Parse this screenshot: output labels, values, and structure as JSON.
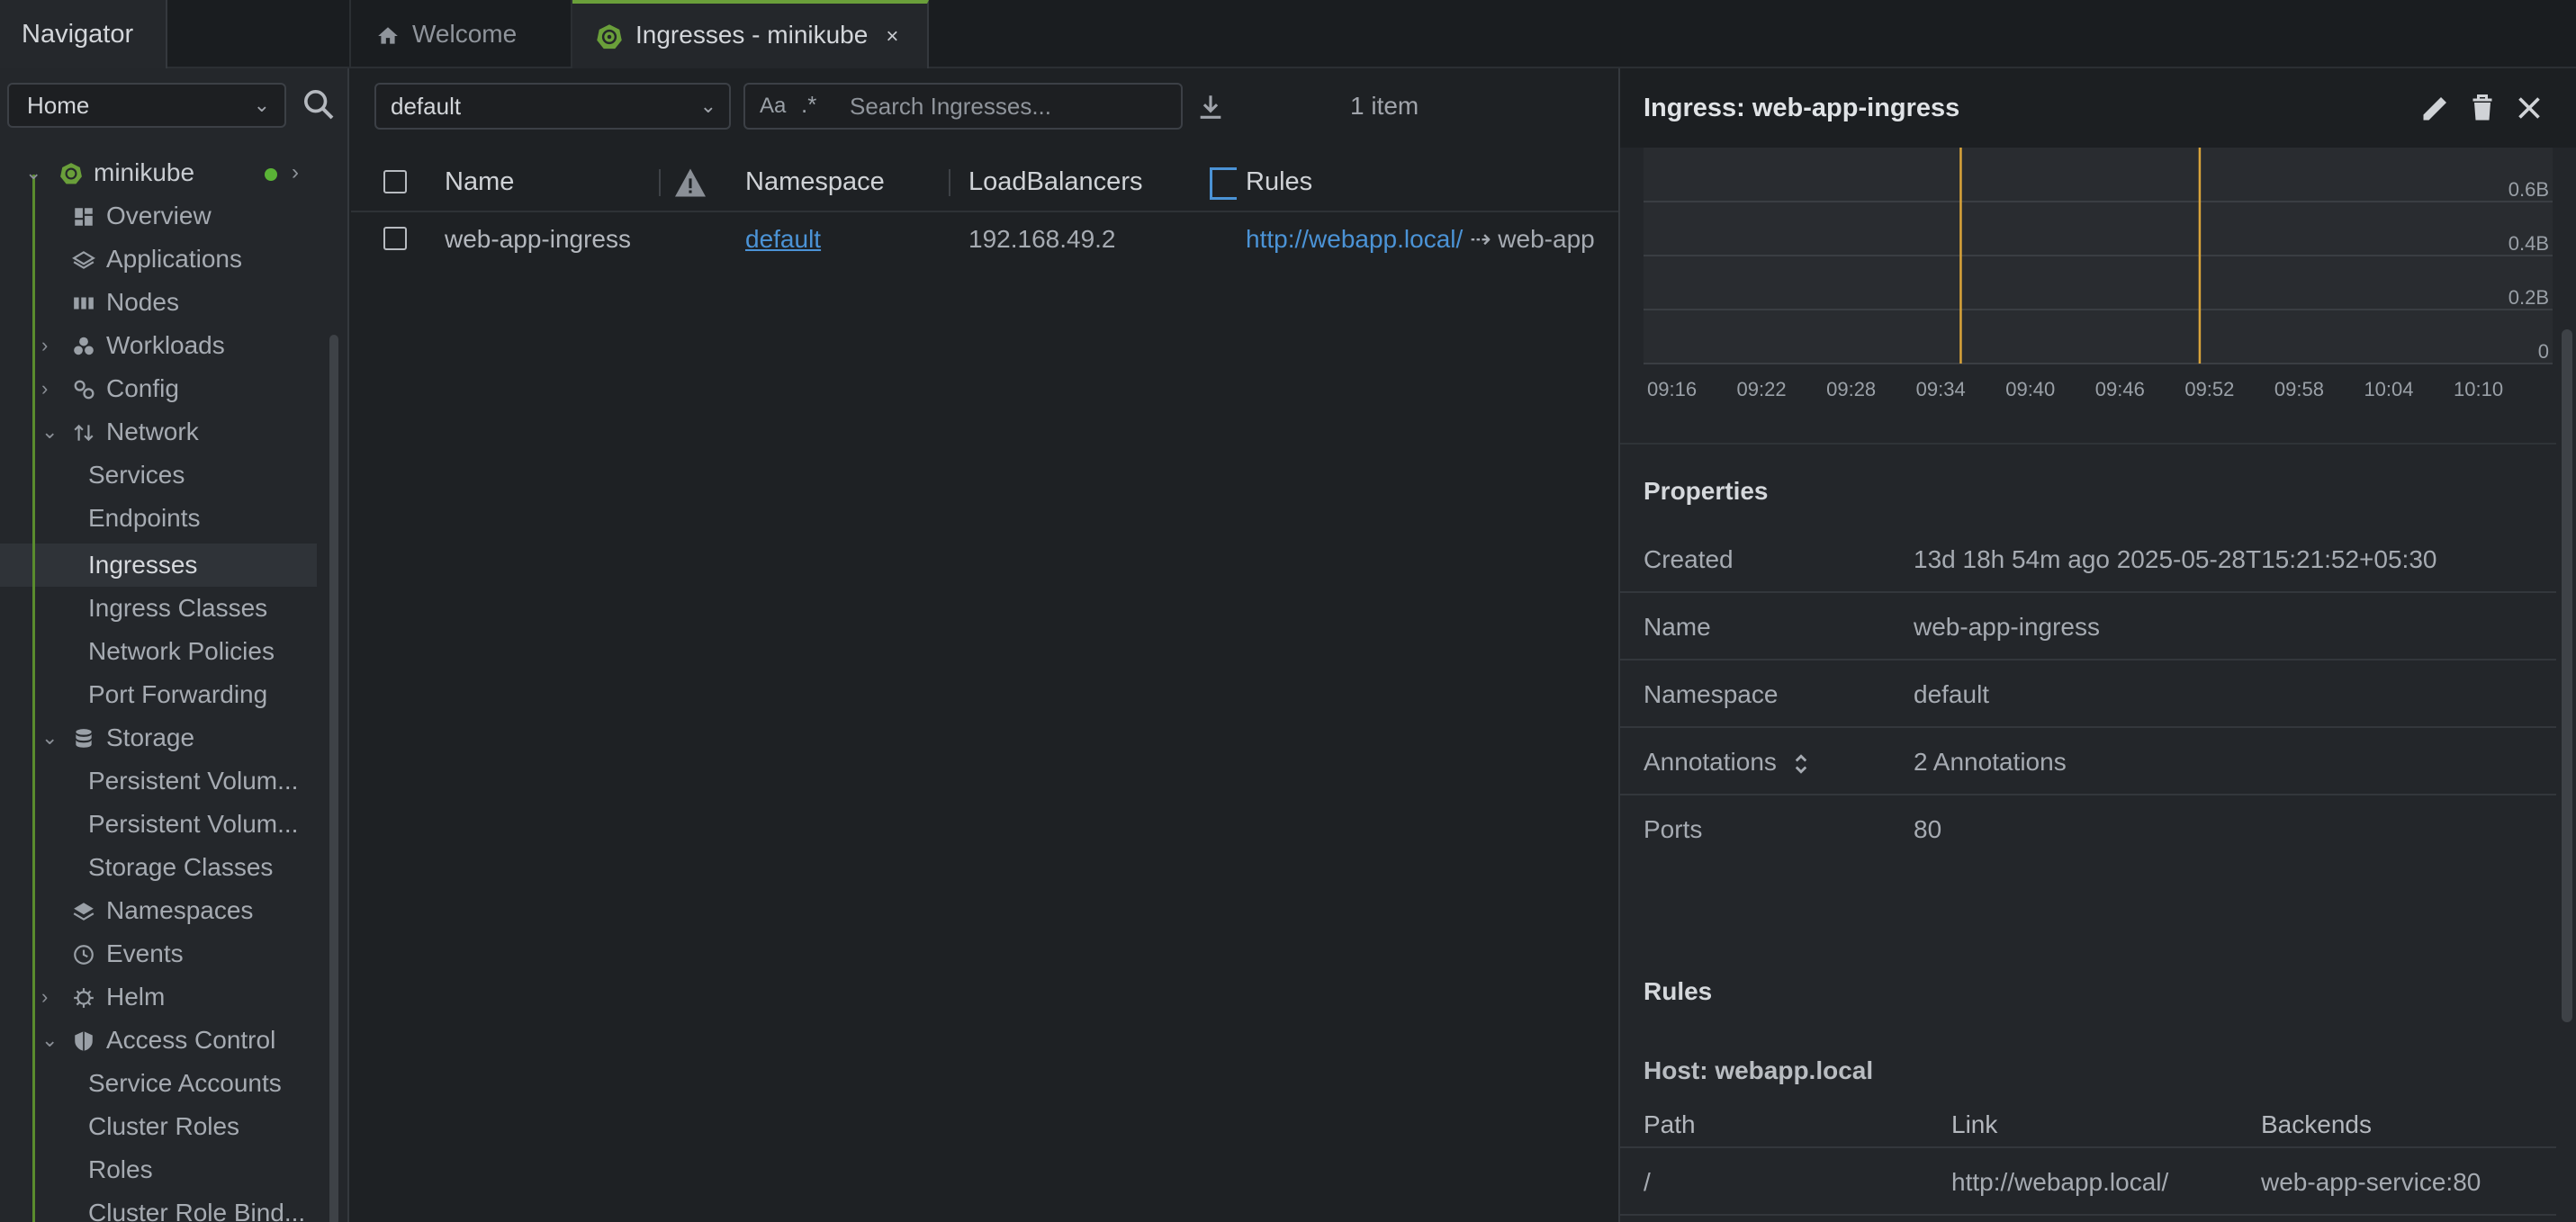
{
  "navigator": {
    "title": "Navigator",
    "home_select": "Home"
  },
  "tabs": [
    {
      "label": "Welcome"
    },
    {
      "label": "Ingresses - minikube",
      "close": "×"
    }
  ],
  "tree": {
    "cluster": "minikube",
    "items": [
      {
        "label": "Overview"
      },
      {
        "label": "Applications"
      },
      {
        "label": "Nodes"
      },
      {
        "label": "Workloads"
      },
      {
        "label": "Config"
      },
      {
        "label": "Network"
      },
      {
        "label": "Services"
      },
      {
        "label": "Endpoints"
      },
      {
        "label": "Ingresses"
      },
      {
        "label": "Ingress Classes"
      },
      {
        "label": "Network Policies"
      },
      {
        "label": "Port Forwarding"
      },
      {
        "label": "Storage"
      },
      {
        "label": "Persistent Volum..."
      },
      {
        "label": "Persistent Volum..."
      },
      {
        "label": "Storage Classes"
      },
      {
        "label": "Namespaces"
      },
      {
        "label": "Events"
      },
      {
        "label": "Helm"
      },
      {
        "label": "Access Control"
      },
      {
        "label": "Service Accounts"
      },
      {
        "label": "Cluster Roles"
      },
      {
        "label": "Roles"
      },
      {
        "label": "Cluster Role Bind..."
      }
    ]
  },
  "toolbar": {
    "namespace_filter": "default",
    "search_aa": "Aa",
    "search_regex": ".*",
    "search_placeholder": "Search Ingresses...",
    "item_count": "1 item"
  },
  "table": {
    "headers": {
      "name": "Name",
      "namespace": "Namespace",
      "loadbalancers": "LoadBalancers",
      "rules": "Rules"
    },
    "rows": [
      {
        "name": "web-app-ingress",
        "namespace": "default",
        "loadbalancers": "192.168.49.2",
        "rule_link": "http://webapp.local/",
        "rule_arrow": "⇢ web-app"
      }
    ]
  },
  "drawer": {
    "title": "Ingress: web-app-ingress",
    "chart_data": {
      "type": "line",
      "x_ticks": [
        "09:16",
        "09:22",
        "09:28",
        "09:34",
        "09:40",
        "09:46",
        "09:52",
        "09:58",
        "10:04",
        "10:10"
      ],
      "y_ticks": [
        "0",
        "0.2B",
        "0.4B",
        "0.6B"
      ],
      "ylim": [
        0,
        0.6
      ],
      "markers_at": [
        "09:37",
        "09:53"
      ],
      "marker_color": "#d9a43a"
    },
    "properties_title": "Properties",
    "properties": [
      {
        "key": "Created",
        "value": "13d 18h 54m ago 2025-05-28T15:21:52+05:30"
      },
      {
        "key": "Name",
        "value": "web-app-ingress"
      },
      {
        "key": "Namespace",
        "value": "default"
      },
      {
        "key": "Annotations",
        "value": "2 Annotations"
      },
      {
        "key": "Ports",
        "value": "80"
      }
    ],
    "rules_title": "Rules",
    "host_title": "Host: webapp.local",
    "rules_headers": {
      "path": "Path",
      "link": "Link",
      "backends": "Backends"
    },
    "rules_row": {
      "path": "/",
      "link": "http://webapp.local/",
      "backends": "web-app-service:80"
    }
  },
  "colors": {
    "accent_green": "#6a9f3a",
    "link_blue": "#4b93d6",
    "status_dot": "#5ab336"
  }
}
